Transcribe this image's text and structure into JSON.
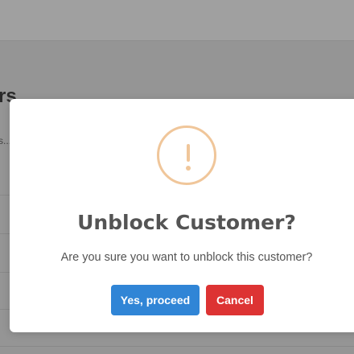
{
  "background": {
    "heading_fragment": "rs",
    "subtext_fragment": "s..."
  },
  "dialog": {
    "icon": "warning-exclamation-icon",
    "icon_color": "#f0c69a",
    "title": "Unblock Customer?",
    "message": "Are you sure you want to unblock this customer?",
    "confirm_label": "Yes, proceed",
    "confirm_color": "#3085d6",
    "cancel_label": "Cancel",
    "cancel_color": "#dd3333"
  }
}
